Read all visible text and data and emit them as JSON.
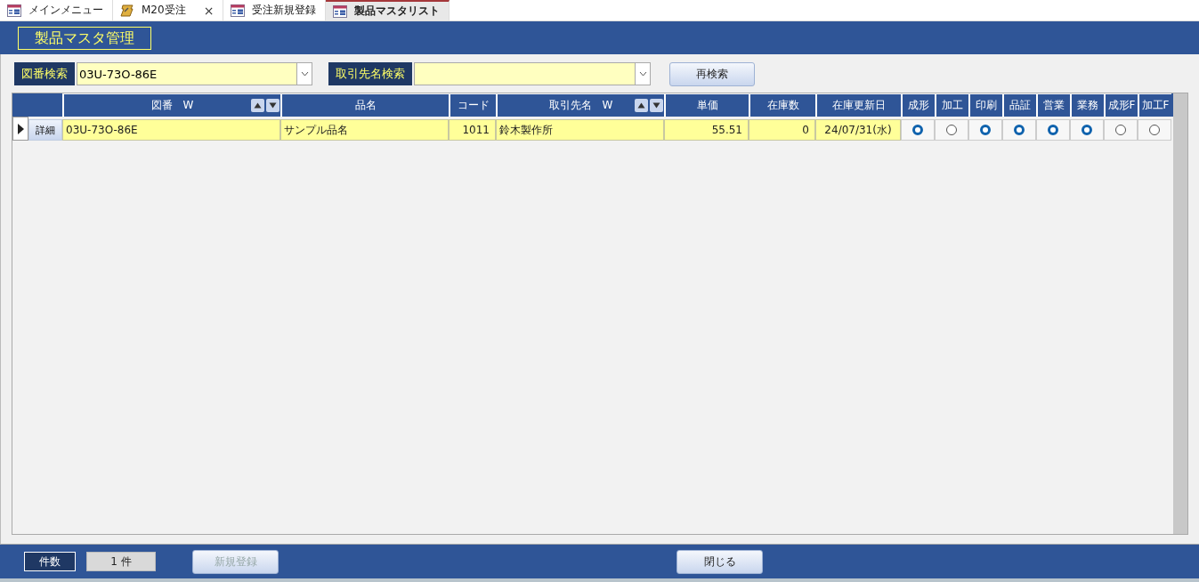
{
  "tabs": [
    {
      "label": "メインメニュー",
      "kind": "form",
      "selected": false
    },
    {
      "label": "M20受注",
      "kind": "macro",
      "selected": false,
      "close": "×"
    },
    {
      "label": "受注新規登録",
      "kind": "form",
      "selected": false
    },
    {
      "label": "製品マスタリスト",
      "kind": "form",
      "selected": true
    }
  ],
  "form_title": "製品マスタ管理",
  "search": [
    {
      "label": "図番検索",
      "value": "03U-73O-86E"
    },
    {
      "label": "取引先名検索"
    }
  ],
  "research_button": "再検索",
  "table": {
    "columns": [
      {
        "label": "図番　W",
        "kind": "text",
        "sortable": true
      },
      {
        "label": "品名",
        "kind": "text",
        "sortable": false
      },
      {
        "label": "コード",
        "kind": "number",
        "sortable": false
      },
      {
        "label": "取引先名　W",
        "kind": "text",
        "sortable": true
      },
      {
        "label": "単価",
        "kind": "number",
        "sortable": false
      },
      {
        "label": "在庫数",
        "kind": "number",
        "sortable": false
      },
      {
        "label": "在庫更新日",
        "kind": "date",
        "sortable": false
      },
      {
        "label": "成形",
        "kind": "radio",
        "sortable": false
      },
      {
        "label": "加工",
        "kind": "radio",
        "sortable": false
      },
      {
        "label": "印刷",
        "kind": "radio",
        "sortable": false
      },
      {
        "label": "品証",
        "kind": "radio",
        "sortable": false
      },
      {
        "label": "営業",
        "kind": "radio",
        "sortable": false
      },
      {
        "label": "業務",
        "kind": "radio",
        "sortable": false
      },
      {
        "label": "成形F",
        "kind": "radio",
        "sortable": false
      },
      {
        "label": "加工F",
        "kind": "radio",
        "sortable": false
      }
    ],
    "rows": [
      {
        "selected": true,
        "detail_button": "詳細",
        "cells": [
          "03U-73O-86E",
          "サンプル品名",
          "1011",
          "鈴木製作所",
          "55.51",
          "0",
          "24/07/31(水)",
          {
            "checked": true
          },
          {
            "checked": false
          },
          {
            "checked": true
          },
          {
            "checked": true
          },
          {
            "checked": true
          },
          {
            "checked": true
          },
          {
            "checked": false
          },
          {
            "checked": false
          }
        ]
      }
    ]
  },
  "footer": {
    "count_label": "件数",
    "count_value": "1 件",
    "new_button": {
      "label": "新規登録",
      "disabled": true
    },
    "close_button": "閉じる"
  }
}
